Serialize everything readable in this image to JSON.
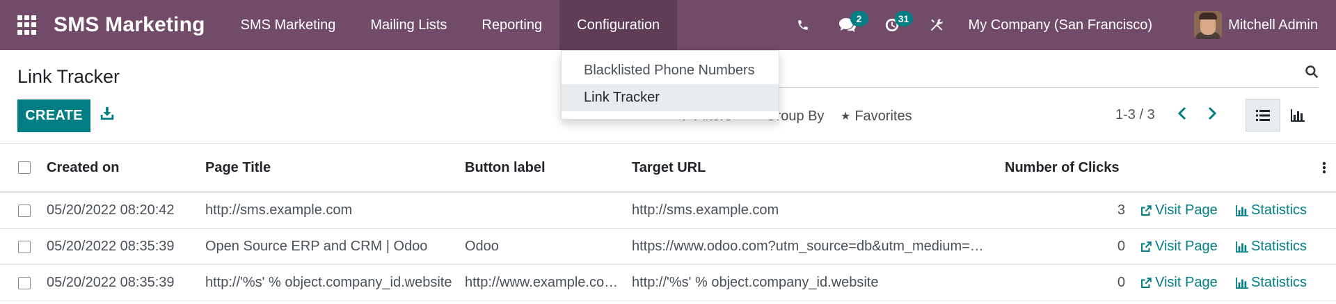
{
  "navbar": {
    "brand": "SMS Marketing",
    "menu": [
      {
        "label": "SMS Marketing"
      },
      {
        "label": "Mailing Lists"
      },
      {
        "label": "Reporting"
      },
      {
        "label": "Configuration"
      }
    ],
    "active_menu": "Configuration",
    "icons": {
      "phone": "phone-icon",
      "chat": "chat-icon",
      "activity": "clock-icon",
      "debug": "tools-icon"
    },
    "chat_badge": "2",
    "activity_badge": "31",
    "company": "My Company (San Francisco)",
    "user": "Mitchell Admin",
    "colors": {
      "navbar": "#714b67",
      "badge": "#017e84"
    }
  },
  "dropdown": {
    "items": [
      {
        "label": "Blacklisted Phone Numbers"
      },
      {
        "label": "Link Tracker"
      }
    ],
    "active": "Link Tracker"
  },
  "control_panel": {
    "title": "Link Tracker",
    "create_label": "CREATE",
    "filters_label": "Filters",
    "group_by_label": "Group By",
    "favorites_label": "Favorites",
    "pager": "1-3 / 3",
    "accent_color": "#017e84"
  },
  "table": {
    "columns": [
      "Created on",
      "Page Title",
      "Button label",
      "Target URL",
      "Number of Clicks"
    ],
    "rows": [
      {
        "created_on": "05/20/2022 08:20:42",
        "page_title": "http://sms.example.com",
        "button_label": "",
        "target_url": "http://sms.example.com",
        "clicks": "3",
        "visit": "Visit Page",
        "stats": "Statistics"
      },
      {
        "created_on": "05/20/2022 08:35:39",
        "page_title": "Open Source ERP and CRM | Odoo",
        "button_label": "Odoo",
        "target_url": "https://www.odoo.com?utm_source=db&utm_medium=…",
        "clicks": "0",
        "visit": "Visit Page",
        "stats": "Statistics"
      },
      {
        "created_on": "05/20/2022 08:35:39",
        "page_title": "http://'%s' % object.company_id.website",
        "button_label": "http://www.example.co…",
        "target_url": "http://'%s' % object.company_id.website",
        "clicks": "0",
        "visit": "Visit Page",
        "stats": "Statistics"
      }
    ]
  }
}
